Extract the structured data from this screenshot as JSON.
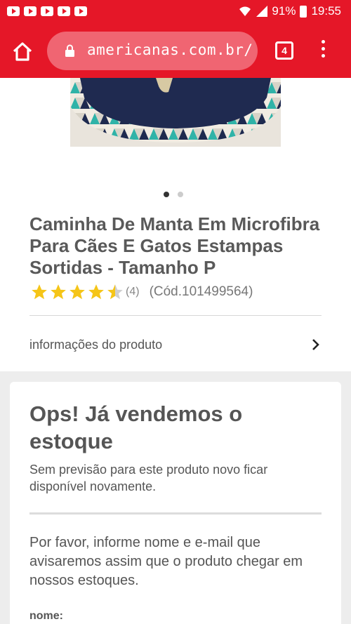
{
  "status_bar": {
    "battery": "91%",
    "time": "19:55"
  },
  "browser": {
    "url": "americanas.com.br/",
    "tab_count": "4"
  },
  "product": {
    "title": "Caminha De Manta Em Microfibra Para Cães E Gatos Estampas Sortidas - Tamanho P",
    "rating": 4.5,
    "rating_max": 5,
    "review_count": "(4)",
    "code": "(Cód.101499564)",
    "info_link": "informações do produto",
    "image_dots": 2,
    "active_dot": 1
  },
  "out_of_stock": {
    "title": "Ops! Já vendemos o estoque",
    "subtitle": "Sem previsão para este produto novo ficar disponível novamente.",
    "notify_text": "Por favor, informe nome e e-mail que avisaremos assim que o produto chegar em nossos estoques.",
    "name_label": "nome:"
  },
  "colors": {
    "brand_red": "#e51728",
    "star_gold": "#f5c518",
    "star_empty": "#cfcfcf"
  }
}
